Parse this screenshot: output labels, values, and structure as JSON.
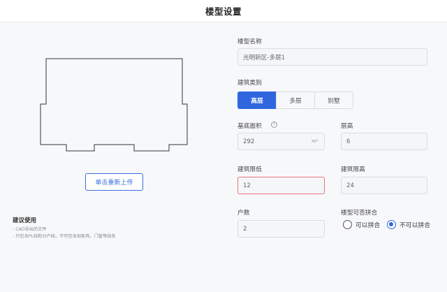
{
  "header": {
    "title": "楼型设置"
  },
  "preview": {
    "upload_button": "单击重新上传",
    "advice_title": "建议使用",
    "advice_lines": [
      "- CAD导出的文件",
      "- 只包含PL线和分户线，不可包含如家具，门窗等线条"
    ]
  },
  "form": {
    "name": {
      "label": "楼型名称",
      "value": "光明新区-多层1"
    },
    "category": {
      "label": "建筑类别",
      "options": [
        "高层",
        "多层",
        "别墅"
      ],
      "selected": "高层"
    },
    "base_area": {
      "label": "基底面积",
      "value": "292",
      "unit": "m²",
      "help_icon": "question-circle-icon"
    },
    "floor_height": {
      "label": "层高",
      "value": "6"
    },
    "min_height": {
      "label": "建筑限低",
      "value": "12"
    },
    "max_height": {
      "label": "建筑限高",
      "value": "24"
    },
    "households": {
      "label": "户数",
      "value": "2"
    },
    "combinable": {
      "label": "楼型可否拼合",
      "options": [
        "可以拼合",
        "不可以拼合"
      ],
      "selected": "不可以拼合"
    }
  },
  "colors": {
    "accent": "#2f66e0",
    "error_border": "#e8757d",
    "background": "#f7f8fa"
  }
}
